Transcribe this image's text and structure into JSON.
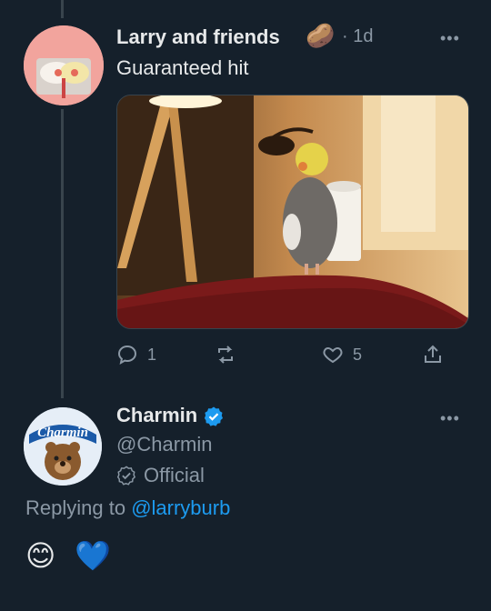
{
  "tweet1": {
    "author_name": "Larry and friends",
    "name_emoji": "🥔",
    "time": "1d",
    "text": "Guaranteed hit",
    "more_label": "•••",
    "actions": {
      "replies": "1",
      "likes": "5"
    }
  },
  "tweet2": {
    "author_name": "Charmin",
    "handle": "@Charmin",
    "affiliation": "Official",
    "more_label": "•••",
    "replying_prefix": "Replying to",
    "replying_handle": "@larryburb",
    "emojis": [
      "😊",
      "💙"
    ]
  },
  "avatar2_text": "Charmin",
  "colors": {
    "background": "#15202b",
    "text": "#e7e9ea",
    "muted": "#8b98a5",
    "accent": "#1d9bf0",
    "divider": "#38444d"
  },
  "icons": [
    "reply-icon",
    "retweet-icon",
    "like-icon",
    "share-icon",
    "verified-badge-icon",
    "official-badge-icon",
    "more-icon"
  ]
}
